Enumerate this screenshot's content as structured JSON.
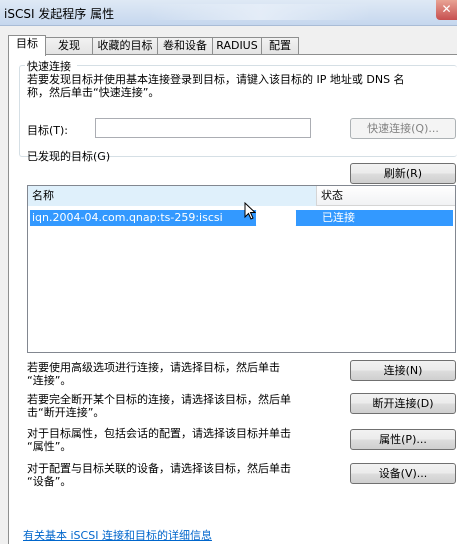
{
  "window": {
    "title": "iSCSI 发起程序 属性",
    "close_glyph": "✕"
  },
  "tabs": [
    {
      "label": "目标",
      "active": true
    },
    {
      "label": "发现",
      "active": false
    },
    {
      "label": "收藏的目标",
      "active": false
    },
    {
      "label": "卷和设备",
      "active": false
    },
    {
      "label": "RADIUS",
      "active": false
    },
    {
      "label": "配置",
      "active": false
    }
  ],
  "quick_connect": {
    "heading": "快速连接",
    "description_line1": "若要发现目标并使用基本连接登录到目标，请键入该目标的 IP 地址或 DNS 名",
    "description_line2": "称，然后单击“快速连接”。",
    "target_label": "目标(T):",
    "target_value": "",
    "button": "快速连接(Q)..."
  },
  "discovered": {
    "heading": "已发现的目标(G)",
    "refresh_button": "刷新(R)",
    "columns": [
      "名称",
      "状态"
    ],
    "rows": [
      {
        "name": "iqn.2004-04.com.qnap:ts-259:iscsi",
        "status": "已连接",
        "selected": true
      }
    ]
  },
  "actions": [
    {
      "text_line1": "若要使用高级选项进行连接，请选择目标，然后单击",
      "text_line2": "“连接”。",
      "button": "连接(N)"
    },
    {
      "text_line1": "若要完全断开某个目标的连接，请选择该目标，然后单",
      "text_line2": "击“断开连接”。",
      "button": "断开连接(D)"
    },
    {
      "text_line1": "对于目标属性，包括会话的配置，请选择该目标并单击",
      "text_line2": "“属性”。",
      "button": "属性(P)..."
    },
    {
      "text_line1": "对于配置与目标关联的设备，请选择该目标，然后单击",
      "text_line2": "“设备”。",
      "button": "设备(V)..."
    }
  ],
  "footer": {
    "link": "有关基本 iSCSI 连接和目标的详细信息"
  },
  "colors": {
    "selection": "#3399ff",
    "link": "#0066cc"
  }
}
